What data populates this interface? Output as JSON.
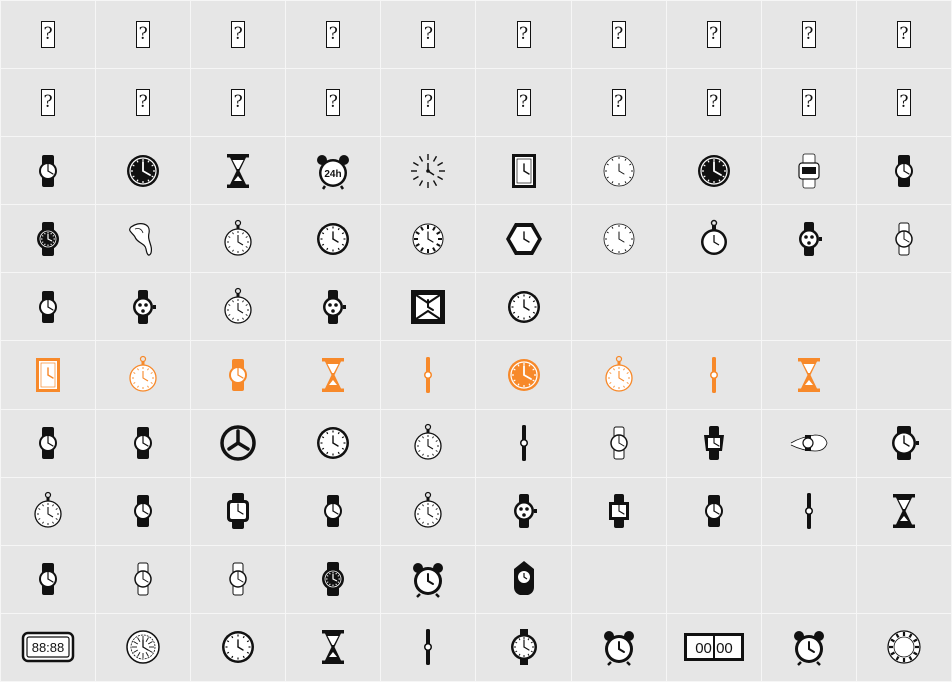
{
  "colors": {
    "dark": "#111111",
    "accent": "#f7892a",
    "light": "#ffffff",
    "cell": "#e6e6e6"
  },
  "glyphs": [
    "missing-glyph",
    "missing-glyph",
    "missing-glyph",
    "missing-glyph",
    "missing-glyph",
    "missing-glyph",
    "missing-glyph",
    "missing-glyph",
    "missing-glyph",
    "missing-glyph",
    "missing-glyph",
    "missing-glyph",
    "missing-glyph",
    "missing-glyph",
    "missing-glyph",
    "missing-glyph",
    "missing-glyph",
    "missing-glyph",
    "missing-glyph",
    "missing-glyph",
    "wristwatch-icon",
    "round-clock-icon",
    "hourglass-icon",
    "alarm-clock-24h-icon",
    "starburst-clock-icon",
    "rectangular-clock-icon",
    "outline-clock-icon",
    "round-clock-icon",
    "digital-watch-outline-icon",
    "wristwatch-icon",
    "sport-watch-icon",
    "melting-clock-icon",
    "pocket-watch-outline-icon",
    "wall-clock-icon",
    "roman-clock-icon",
    "hexagon-clock-icon",
    "outline-clock-icon",
    "pocket-watch-icon",
    "chronograph-watch-icon",
    "wristwatch-outline-icon",
    "wristwatch-icon",
    "chronograph-watch-icon",
    "pocket-watch-outline-icon",
    "chronograph-watch-icon",
    "square-clock-icon",
    "wall-clock-icon",
    "empty",
    "empty",
    "empty",
    "empty",
    "rectangular-clock-icon",
    "pocket-watch-outline-icon",
    "wristwatch-icon",
    "hourglass-icon",
    "thin-watch-icon",
    "round-clock-icon",
    "pocket-watch-outline-icon",
    "thin-watch-icon",
    "hourglass-icon",
    "empty",
    "wristwatch-icon",
    "wristwatch-icon",
    "minimal-clock-icon",
    "wall-clock-icon",
    "pocket-watch-outline-icon",
    "thin-watch-icon",
    "wristwatch-outline-icon",
    "square-watch-icon",
    "watch-on-wrist-icon",
    "field-watch-icon",
    "pocket-watch-outline-icon",
    "wristwatch-icon",
    "smartwatch-icon",
    "wristwatch-icon",
    "pocket-watch-outline-icon",
    "chronograph-watch-icon",
    "square-watch-outline-icon",
    "wristwatch-icon",
    "thin-watch-icon",
    "hourglass-icon",
    "wristwatch-icon",
    "wristwatch-outline-icon",
    "wristwatch-outline-icon",
    "sport-watch-icon",
    "alarm-clock-icon",
    "cuckoo-clock-icon",
    "empty",
    "empty",
    "empty",
    "empty",
    "digital-clock-icon",
    "ornate-clock-icon",
    "wall-clock-icon",
    "hourglass-icon",
    "thin-watch-icon",
    "round-watch-icon",
    "alarm-clock-icon",
    "flip-clock-icon",
    "alarm-clock-icon",
    "roman-clock-outline-icon"
  ],
  "accent_cells": [
    50,
    51,
    52,
    53,
    54,
    55,
    56,
    57,
    58
  ],
  "labels": {
    "alarm24": "24h",
    "digital": "88:88",
    "flip": "00:00",
    "missing": "?"
  }
}
